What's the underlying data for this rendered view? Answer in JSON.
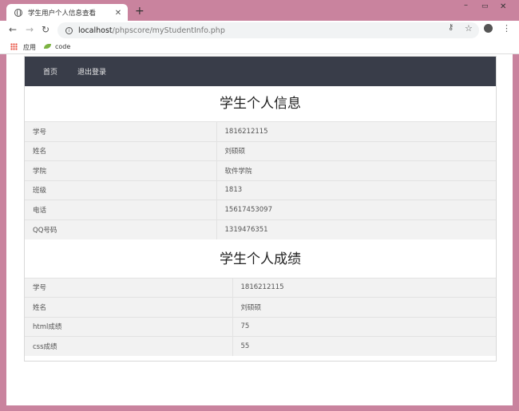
{
  "browser": {
    "tab_title": "学生用户个人信息查看",
    "url_host": "localhost",
    "url_path": "/phpscore/myStudentInfo.php",
    "bookmarks": [
      {
        "label": "应用"
      },
      {
        "label": "code"
      }
    ]
  },
  "navbar": {
    "home": "首页",
    "logout": "退出登录"
  },
  "info_section": {
    "title": "学生个人信息",
    "rows": [
      {
        "label": "学号",
        "value": "1816212115"
      },
      {
        "label": "姓名",
        "value": "刘硕硕"
      },
      {
        "label": "学院",
        "value": "软件学院"
      },
      {
        "label": "班级",
        "value": "1813"
      },
      {
        "label": "电话",
        "value": "15617453097"
      },
      {
        "label": "QQ号码",
        "value": "1319476351"
      }
    ]
  },
  "grade_section": {
    "title": "学生个人成绩",
    "rows": [
      {
        "label": "学号",
        "value": "1816212115"
      },
      {
        "label": "姓名",
        "value": "刘硕硕"
      },
      {
        "label": "html成绩",
        "value": "75"
      },
      {
        "label": "css成绩",
        "value": "55"
      }
    ]
  },
  "colors": {
    "window_frame": "#c9839e",
    "navbar_bg": "#393d49",
    "row_bg": "#f2f2f2"
  },
  "icons": [
    "globe-icon",
    "close-icon",
    "plus-icon",
    "back-arrow-icon",
    "forward-arrow-icon",
    "reload-icon",
    "info-icon",
    "key-icon",
    "star-icon",
    "account-icon",
    "menu-icon",
    "apps-grid-icon",
    "leaf-icon"
  ]
}
